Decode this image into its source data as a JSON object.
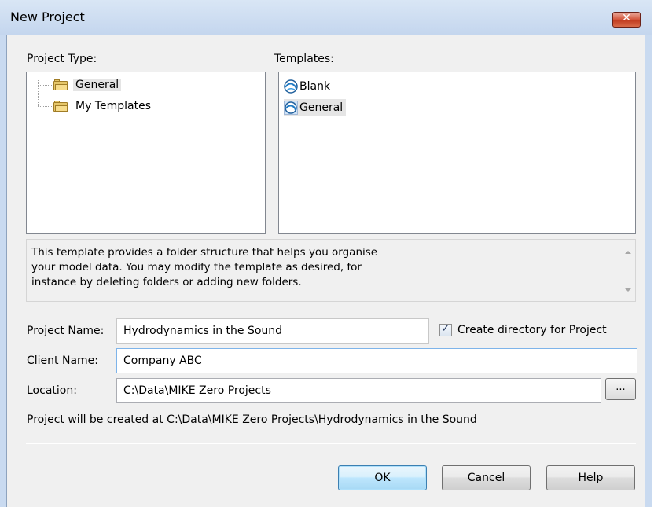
{
  "window": {
    "title": "New Project",
    "close_glyph": "✕"
  },
  "project_type": {
    "label": "Project Type:",
    "items": [
      {
        "label": "General",
        "icon": "folder-icon",
        "selected": true
      },
      {
        "label": "My Templates",
        "icon": "folder-icon",
        "selected": false
      }
    ]
  },
  "templates": {
    "label": "Templates:",
    "items": [
      {
        "label": "Blank",
        "icon": "template-icon",
        "selected": false
      },
      {
        "label": "General",
        "icon": "template-icon",
        "selected": true
      }
    ]
  },
  "description": {
    "lines": [
      "This template provides a folder structure that helps you organise",
      "your model data. You may modify the template as desired, for",
      "instance by deleting folders or adding new folders."
    ]
  },
  "form": {
    "project_name_label": "Project Name:",
    "project_name_value": "Hydrodynamics in the Sound",
    "create_dir_label": "Create directory for Project",
    "create_dir_checked": true,
    "check_glyph": "✓",
    "client_name_label": "Client Name:",
    "client_name_value": "Company ABC",
    "location_label": "Location:",
    "location_value": "C:\\Data\\MIKE Zero Projects",
    "browse_label": "...",
    "created_at_text": "Project will be created at C:\\Data\\MIKE Zero Projects\\Hydrodynamics in the Sound"
  },
  "buttons": {
    "ok": "OK",
    "cancel": "Cancel",
    "help": "Help"
  },
  "colors": {
    "title_bar": "#c4d6ee",
    "close_button": "#c0391d",
    "dialog_body": "#f0f0f0",
    "ok_border": "#3c7fb1",
    "focus_border": "#7eb4ea"
  }
}
